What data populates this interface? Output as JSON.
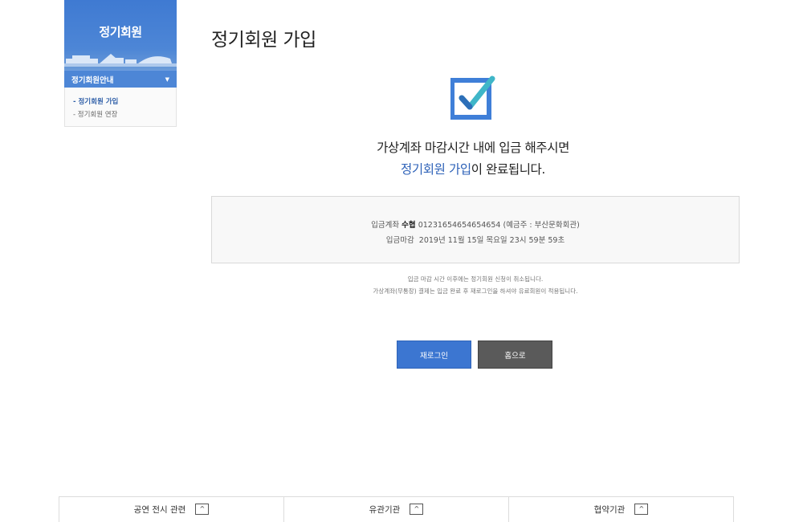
{
  "sidebar": {
    "title": "정기회원",
    "menu_label": "정기회원안내",
    "menu_caret": "▼",
    "items": [
      {
        "label": "- 정기회원 가입"
      },
      {
        "label": "- 정기회원 연장"
      }
    ]
  },
  "main": {
    "page_title": "정기회원 가입",
    "message_line1": "가상계좌 마감시간 내에 입금 해주시면",
    "message_line2_highlight": "정기회원 가입",
    "message_line2_rest": "이 완료됩니다.",
    "account": {
      "label": "입금계좌",
      "bank": "수협",
      "number": "01231654654654654",
      "holder": "(예금주 : 부산문화회관)"
    },
    "deadline": {
      "label": "입금마감",
      "value": "2019년 11월 15일 목요일 23시 59분 59초"
    },
    "note1": "입금 마감 시간 이후에는 정기회원 신청이 취소됩니다.",
    "note2": "가상계좌(무통장) 결제는 입금 완료 후 재로그인을 하셔야 유료회원이 적용됩니다.",
    "buttons": {
      "relogin": "재로그인",
      "home": "홈으로"
    }
  },
  "footer": {
    "items": [
      {
        "label": "공연 전시 관련",
        "icon": "chevron-up-icon"
      },
      {
        "label": "유관기관",
        "icon": "chevron-up-icon"
      },
      {
        "label": "협약기관",
        "icon": "chevron-up-icon"
      }
    ],
    "up_glyph": "^"
  },
  "colors": {
    "accent": "#3c76d1",
    "highlight_text": "#2e62b8",
    "home_button": "#5a5a5a",
    "check_icon_blue": "#3f7fd8",
    "check_icon_teal": "#3fb6c8"
  }
}
